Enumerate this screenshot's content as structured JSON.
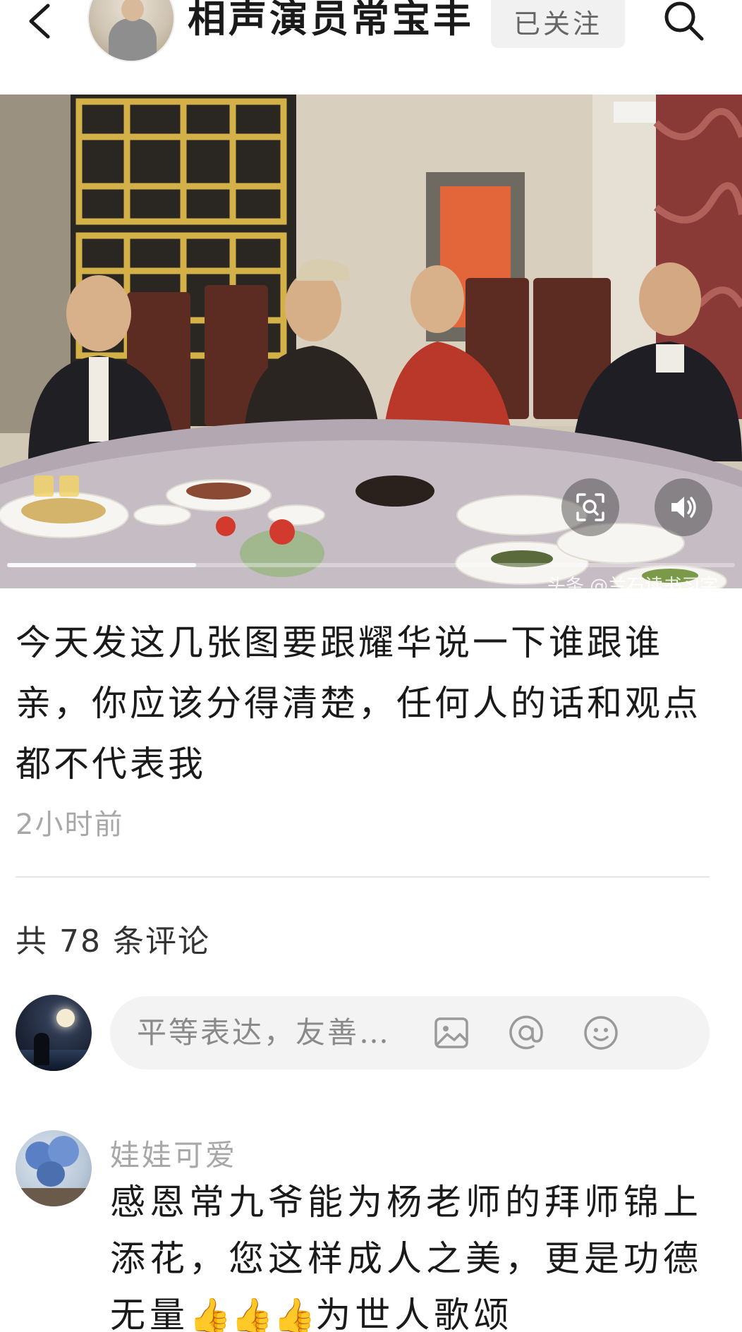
{
  "header": {
    "back_icon": "chevron-left-icon",
    "title": "相声演员常宝丰",
    "follow_label": "已关注",
    "search_icon": "search-icon"
  },
  "photo": {
    "watermark": "头条 @兰石读书习字",
    "progress": 0.26,
    "lens_icon": "image-search-icon",
    "volume_icon": "volume-icon"
  },
  "post": {
    "text": "今天发这几张图要跟耀华说一下谁跟谁亲，你应该分得清楚，任何人的话和观点都不代表我",
    "time": "2小时前"
  },
  "comments": {
    "count_label": "共 78 条评论",
    "input_placeholder": "平等表达，友善…",
    "input_icons": [
      "image-icon",
      "at-icon",
      "emoji-icon"
    ],
    "items": [
      {
        "username": "娃娃可爱",
        "text_before": "感恩常九爷能为杨老师的拜师锦上添花，您这样成人之美，更是功德无量",
        "emojis": "👍👍👍",
        "text_after": "为世人歌颂"
      }
    ]
  },
  "colors": {
    "follow_bg": "#f1f1f1",
    "muted_text": "#a8a8a8",
    "input_bg": "#f3f3f3"
  }
}
